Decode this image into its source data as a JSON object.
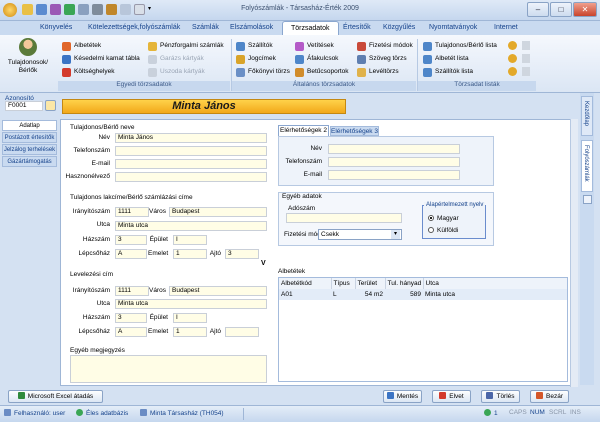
{
  "window": {
    "title": "Folyószámlák - Társasház-Érték 2009"
  },
  "ribbon_tabs": [
    "Könyvelés",
    "Kötelezettségek,folyószámlák",
    "Számlák",
    "Elszámolások",
    "Törzsadatok",
    "Értesítők",
    "Közgyűlés",
    "Nyomtatványok",
    "Internet"
  ],
  "ribbon": {
    "big_button": "Tulajdonosok/ Bérlők",
    "group1": {
      "label": "Egyedi törzsadatok",
      "col1": [
        "Albetétek",
        "Késedelmi kamat tábla",
        "Költséghelyek"
      ],
      "col2": [
        "Pénzforgalmi számlák",
        "Garázs kártyák",
        "Uszoda kártyák"
      ]
    },
    "group2": {
      "label": "Általános törzsadatok",
      "col1": [
        "Szállítók",
        "Jogcímek",
        "Főkönyvi törzs"
      ],
      "col2": [
        "Vetítések",
        "Áfakulcsok",
        "Betűcsoportok"
      ],
      "col3": [
        "Fizetési módok",
        "Szöveg törzs",
        "Levéltörzs"
      ]
    },
    "group3": {
      "label": "Törzsadat listák",
      "col1": [
        "Tulajdonos/Bérlő lista",
        "Albetét lista",
        "Szállítók lista"
      ]
    }
  },
  "left": {
    "azonosito_label": "Azonosító",
    "azonosito_value": "F0001",
    "nav": [
      "Adatlap",
      "Postázott értesítők",
      "Jelzálog terhelések",
      "Gázártámogatás"
    ]
  },
  "header_name": "Minta János",
  "right_tabs": [
    "Kezdőlap",
    "Folyószámlák"
  ],
  "owner": {
    "title": "Tulajdonos/Bérlő neve",
    "nev_label": "Név",
    "nev": "Minta János",
    "tel_label": "Telefonszám",
    "tel": "",
    "email_label": "E-mail",
    "email": "",
    "haszon_label": "Hasznonélvező",
    "haszon": ""
  },
  "address": {
    "title": "Tulajdonos lakcíme/Bérlő számlázási címe",
    "irsz_label": "Irányítószám",
    "irsz": "1111",
    "varos_label": "Város",
    "varos": "Budapest",
    "utca_label": "Utca",
    "utca": "Minta utca",
    "hazszam_label": "Házszám",
    "hazszam": "3",
    "epulet_label": "Épület",
    "epulet": "I",
    "lepcso_label": "Lépcsőház",
    "lepcso": "A",
    "emelet_label": "Emelet",
    "emelet": "1",
    "ajto_label": "Ajtó",
    "ajto": "3",
    "v_mark": "V"
  },
  "mail": {
    "title": "Levelezési cím",
    "irsz": "1111",
    "varos": "Budapest",
    "utca": "Minta utca",
    "hazszam": "3",
    "epulet": "I",
    "lepcso": "A",
    "emelet": "1",
    "ajto": ""
  },
  "notes_label": "Egyéb megjegyzés",
  "contacts": {
    "tabs": [
      "Elérhetőségek 2",
      "Elérhetőségek 3"
    ],
    "nev_label": "Név",
    "tel_label": "Telefonszám",
    "email_label": "E-mail"
  },
  "other": {
    "title": "Egyéb adatok",
    "adoszam_label": "Adószám",
    "fizmod_label": "Fizetési mód",
    "fizmod_value": "Csekk",
    "lang_title": "Alapértelmezett nyelv",
    "lang_options": [
      "Magyar",
      "Külföldi"
    ],
    "lang_selected": "Magyar"
  },
  "albetetek": {
    "title": "Albetétek",
    "headers": [
      "Albetétkód",
      "Típus",
      "Terület",
      "Tul. hányad",
      "Utca"
    ],
    "rows": [
      [
        "A01",
        "L",
        "54 m2",
        "589",
        "Minta utca"
      ]
    ]
  },
  "buttons": {
    "excel": "Microsoft Excel átadás",
    "mentes": "Mentés",
    "elvet": "Elvet",
    "torles": "Törlés",
    "bezar": "Bezár"
  },
  "status": {
    "user": "Felhasználó: user",
    "db": "Éles adatbázis",
    "house": "Minta Társasház (TH054)",
    "page": "1",
    "keys": [
      "CAPS",
      "NUM",
      "SCRL",
      "INS"
    ]
  },
  "colors": {
    "accent": "#f4b41a",
    "header_bg": "#f7b71e",
    "brand_blue": "#15428b"
  }
}
